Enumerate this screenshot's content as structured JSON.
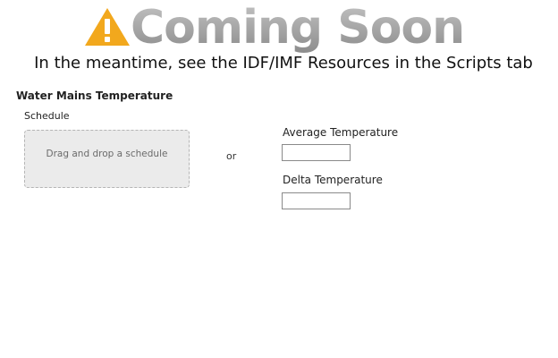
{
  "banner": {
    "icon": "warning-icon",
    "icon_color": "#f2a81d",
    "headline": "Coming Soon",
    "subtitle": "In the meantime, see the IDF/IMF Resources in the Scripts tab"
  },
  "section": {
    "title": "Water Mains Temperature",
    "schedule_label": "Schedule",
    "drop_zone_text": "Drag and drop a schedule",
    "or_text": "or",
    "average_label": "Average Temperature",
    "average_value": "",
    "delta_label": "Delta Temperature",
    "delta_value": ""
  }
}
